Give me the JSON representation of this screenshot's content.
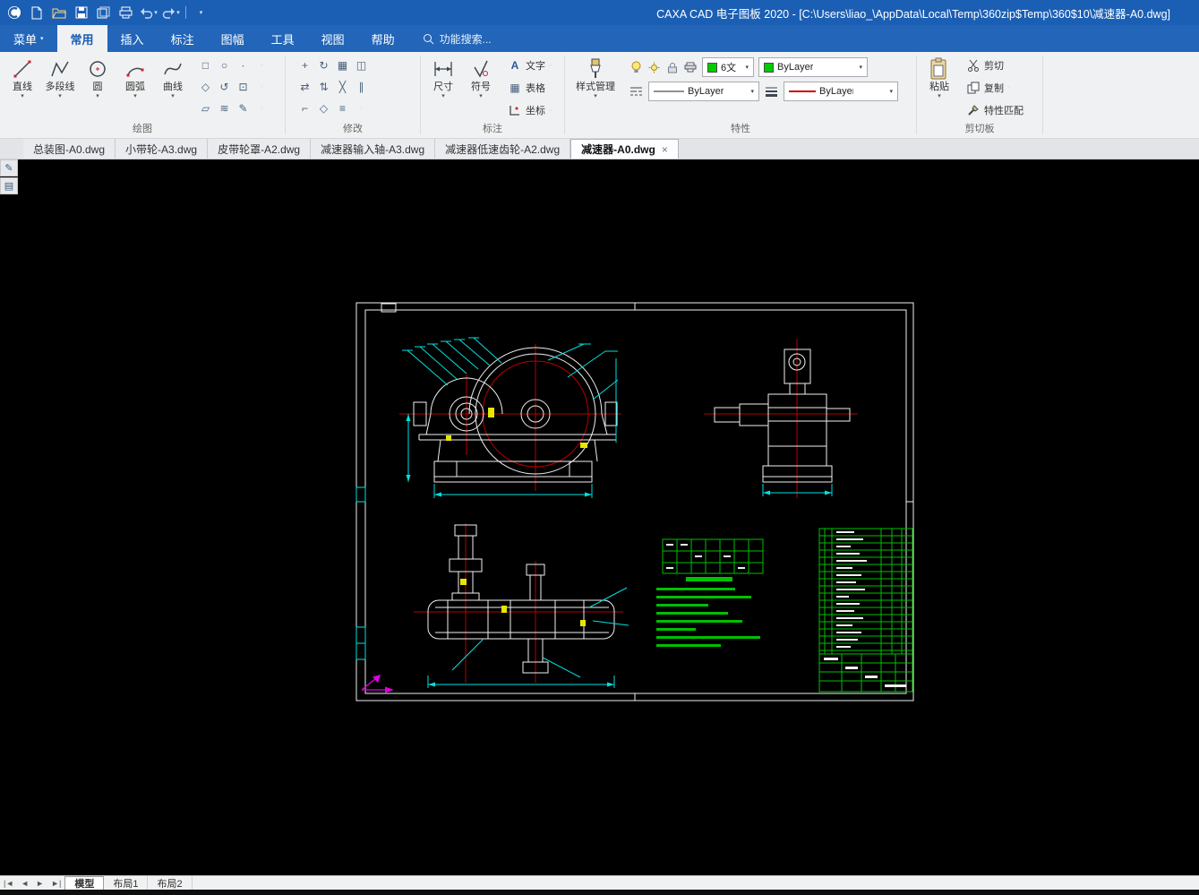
{
  "colors": {
    "titlebar": "#1b5fb4",
    "menubar": "#2265b9",
    "accent": "#1b5fb4",
    "canvas-bg": "#000000",
    "cad-white": "#f0f0f0",
    "cad-cyan": "#00e0e0",
    "cad-green": "#00c000",
    "cad-red": "#b80000",
    "cad-yellow": "#e6e600",
    "cad-magenta": "#dd00dd",
    "layer-green": "#00cc00"
  },
  "titlebar": {
    "title": "CAXA CAD 电子图板 2020 - [C:\\Users\\liao_\\AppData\\Local\\Temp\\360zip$Temp\\360$10\\减速器-A0.dwg]"
  },
  "menu": {
    "items": [
      "菜单",
      "常用",
      "插入",
      "标注",
      "图幅",
      "工具",
      "视图",
      "帮助"
    ],
    "search": "功能搜索..."
  },
  "ribbon": {
    "draw": {
      "label": "绘图",
      "tools": [
        {
          "label": "直线"
        },
        {
          "label": "多段线"
        },
        {
          "label": "圆"
        },
        {
          "label": "圆弧"
        },
        {
          "label": "曲线"
        }
      ]
    },
    "modify": {
      "label": "修改"
    },
    "annotate": {
      "label": "标注",
      "dimension": "尺寸",
      "symbol": "符号",
      "text": "文字",
      "table": "表格",
      "coordinate": "坐标"
    },
    "properties": {
      "label": "特性",
      "style_manager": "样式管理",
      "layer": "6文",
      "color": "ByLayer",
      "linetype": "ByLayer",
      "lineweight": "ByLayer"
    },
    "clipboard": {
      "label": "剪切板",
      "paste": "粘贴",
      "cut": "剪切",
      "copy": "复制",
      "match": "特性匹配"
    }
  },
  "doc_tabs": [
    {
      "label": "总装图-A0.dwg"
    },
    {
      "label": "小带轮-A3.dwg"
    },
    {
      "label": "皮带轮罩-A2.dwg"
    },
    {
      "label": "减速器输入轴-A3.dwg"
    },
    {
      "label": "减速器低速齿轮-A2.dwg"
    },
    {
      "label": "减速器-A0.dwg",
      "close": "×"
    }
  ],
  "layout_tabs": {
    "model": "模型",
    "layout1": "布局1",
    "layout2": "布局2"
  }
}
